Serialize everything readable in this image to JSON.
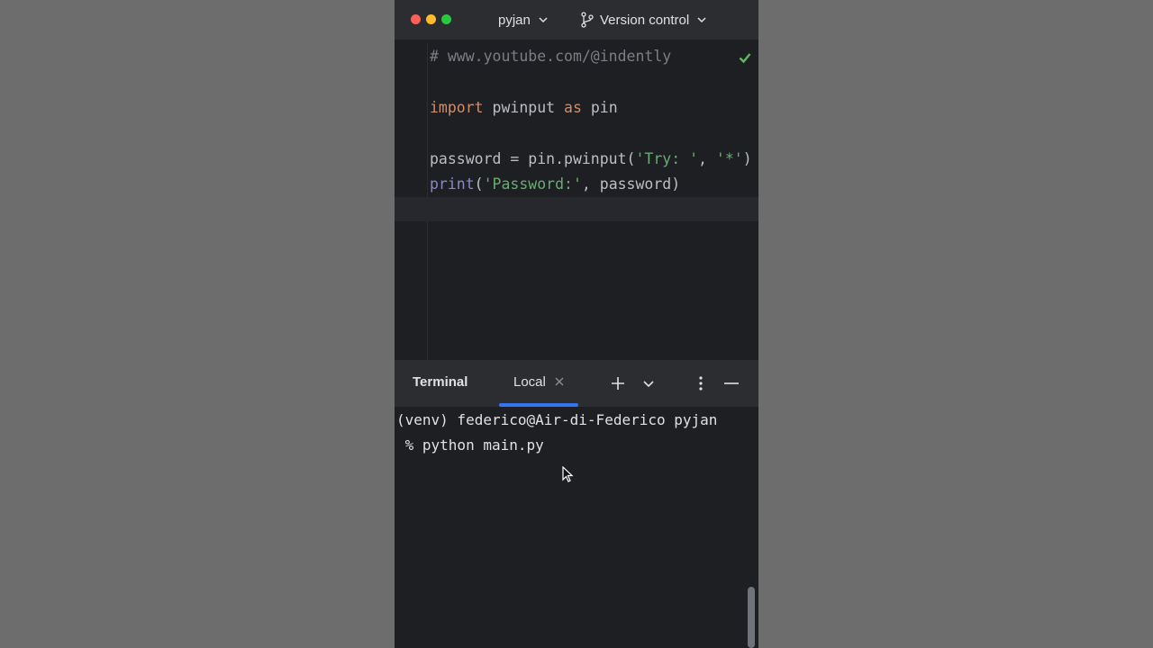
{
  "titlebar": {
    "project": "pyjan",
    "vcs": "Version control"
  },
  "editor": {
    "lines": [
      {
        "comment": "# www.youtube.com/@indently"
      },
      {
        "kw_import": "import",
        "module": " pwinput ",
        "kw_as": "as",
        "alias": " pin"
      },
      {
        "var": "password = pin.pwinput(",
        "str1": "'Try: '",
        "sep": ", ",
        "str2": "'*'",
        "end": ")"
      },
      {
        "builtin": "print",
        "open": "(",
        "str": "'Password:'",
        "rest": ", password)"
      }
    ]
  },
  "terminal": {
    "title": "Terminal",
    "tab_label": "Local",
    "prompt_line1": "(venv) federico@Air-di-Federico pyjan",
    "prompt_line2": " % python main.py"
  },
  "icons": {
    "close": "close-icon",
    "add": "plus-icon",
    "dropdown": "chevron-down-icon",
    "more": "more-vertical-icon",
    "minimize": "minimize-icon",
    "inspection_ok": "check-icon",
    "branch": "branch-icon"
  },
  "colors": {
    "accent": "#3574f0",
    "ok": "#5fb865"
  }
}
